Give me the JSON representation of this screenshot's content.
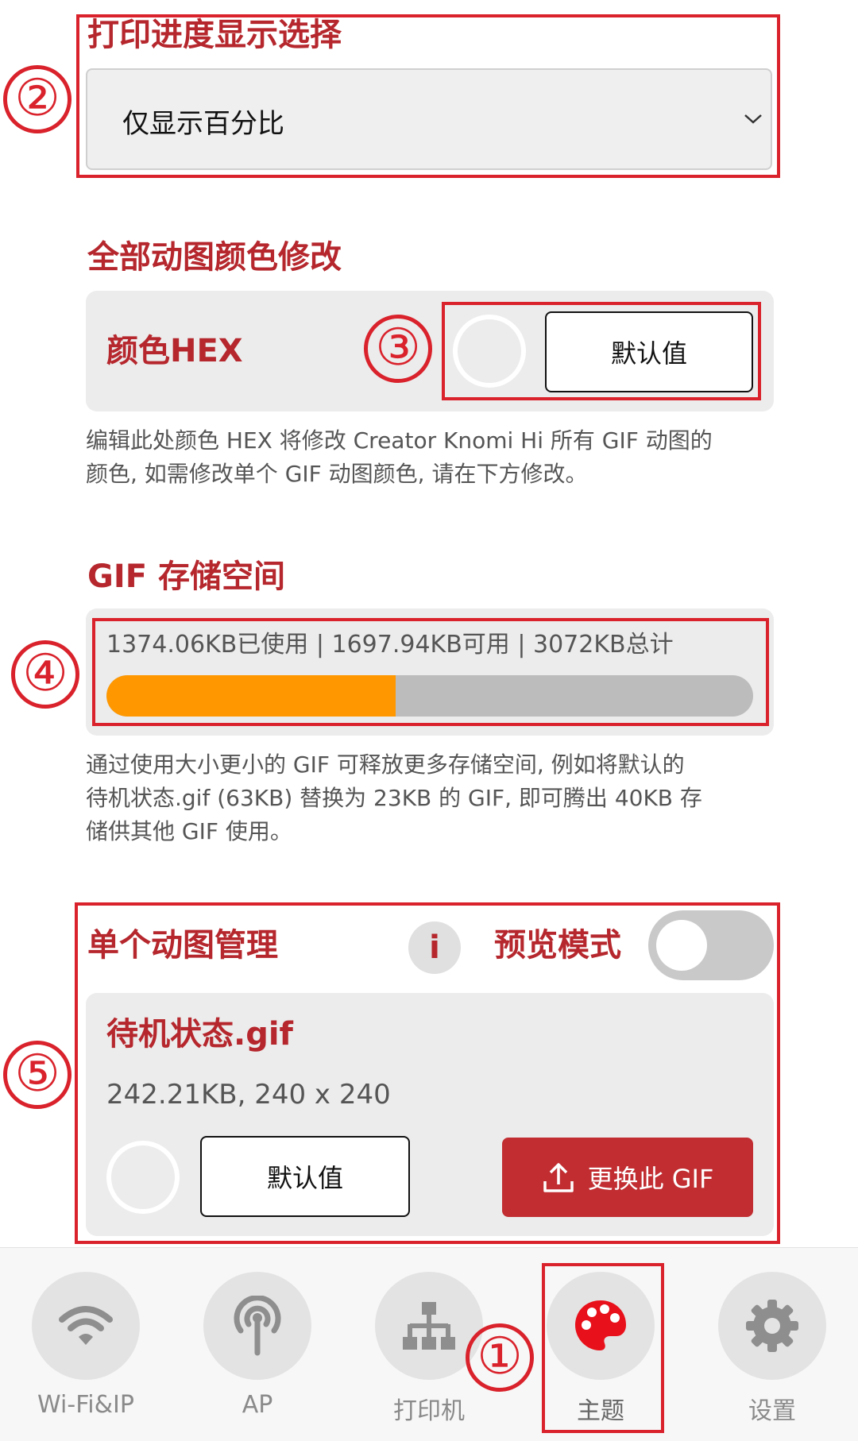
{
  "progress_display": {
    "title": "打印进度显示选择",
    "selected": "仅显示百分比"
  },
  "global_color": {
    "title": "全部动图颜色修改",
    "label": "颜色HEX",
    "default_button": "默认值",
    "help_line1": "编辑此处颜色 HEX 将修改 Creator Knomi Hi 所有 GIF 动图的",
    "help_line2": "颜色, 如需修改单个 GIF 动图颜色, 请在下方修改。"
  },
  "storage": {
    "title": "GIF 存储空间",
    "summary": "1374.06KB已使用 | 1697.94KB可用 | 3072KB总计",
    "used_fraction": 0.4473,
    "help_line1": "通过使用大小更小的 GIF 可释放更多存储空间, 例如将默认的",
    "help_line2": "待机状态.gif (63KB) 替换为 23KB 的 GIF, 即可腾出 40KB 存",
    "help_line3": "储供其他 GIF 使用。"
  },
  "single_gif": {
    "title": "单个动图管理",
    "info_icon_text": "i",
    "preview_label": "预览模式",
    "preview_on": false,
    "file_name": "待机状态.gif",
    "file_info": "242.21KB, 240 x 240",
    "default_button": "默认值",
    "replace_button": "更换此 GIF"
  },
  "nav": {
    "items": [
      {
        "label": "Wi-Fi&IP",
        "icon": "wifi-icon"
      },
      {
        "label": "AP",
        "icon": "antenna-icon"
      },
      {
        "label": "打印机",
        "icon": "network-icon"
      },
      {
        "label": "主题",
        "icon": "palette-icon",
        "active": true
      },
      {
        "label": "设置",
        "icon": "gear-icon"
      }
    ]
  },
  "annotations": [
    "①",
    "②",
    "③",
    "④",
    "⑤"
  ],
  "colors": {
    "accent": "#b5272d",
    "annotation": "#d9222b",
    "progress_fill": "#ff9800",
    "progress_track": "#bcbcbc",
    "palette": "#e8101a"
  }
}
